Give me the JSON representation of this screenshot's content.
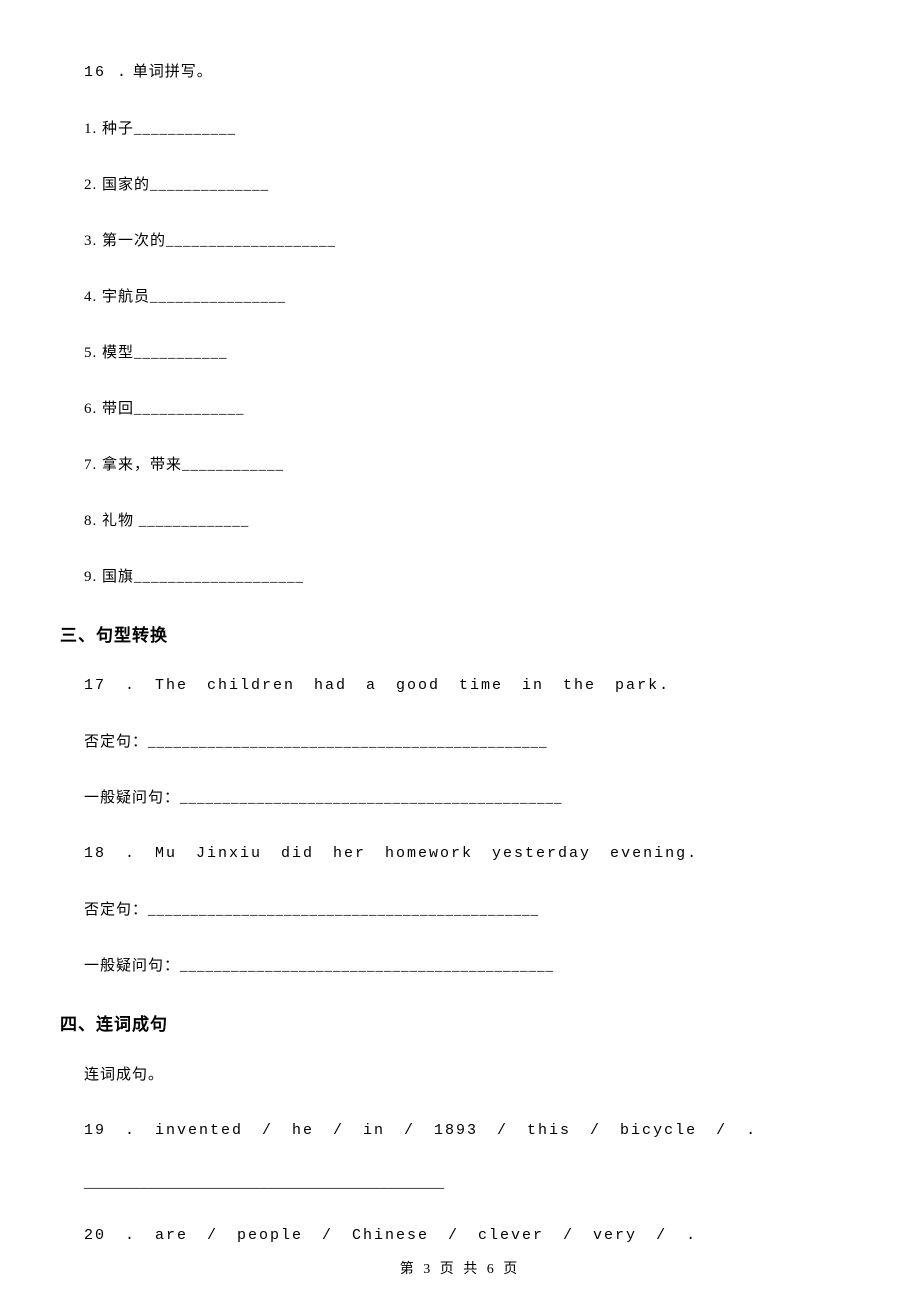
{
  "q16": {
    "num": "16 .",
    "title": "单词拼写。",
    "items": [
      "1. 种子____________",
      "2. 国家的______________",
      "3. 第一次的____________________",
      "4. 宇航员________________",
      "5. 模型___________",
      "6. 带回_____________",
      "7. 拿来，带来____________",
      "8. 礼物  _____________",
      "9. 国旗____________________"
    ]
  },
  "section3": {
    "heading": "三、句型转换"
  },
  "q17": {
    "text": "17 . The  children  had  a  good  time  in  the  park.",
    "neg": "否定句：_______________________________________________",
    "gen": "一般疑问句：_____________________________________________"
  },
  "q18": {
    "text": "18 . Mu  Jinxiu  did  her  homework  yesterday  evening.",
    "neg": "否定句：______________________________________________",
    "gen": "一般疑问句：____________________________________________"
  },
  "section4": {
    "heading": "四、连词成句",
    "sub": "连词成句。"
  },
  "q19": {
    "text": "19 . invented  /  he  /  in  /  1893  /  this  /  bicycle  /  .",
    "blank": "________________________________________________"
  },
  "q20": {
    "text": "20 . are  /  people  /  Chinese  /  clever  /  very  /  ."
  },
  "footer": "第 3 页 共 6 页"
}
